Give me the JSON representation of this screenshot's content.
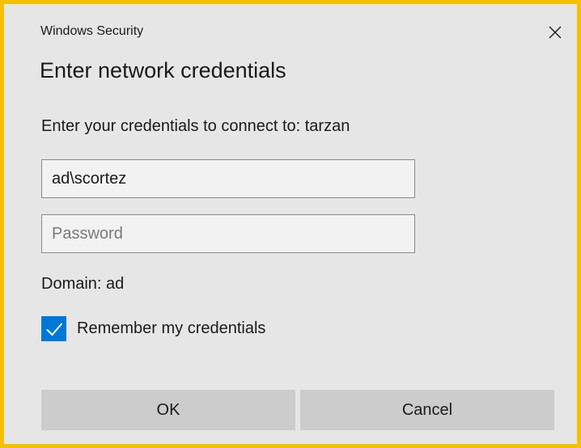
{
  "window": {
    "title": "Windows Security",
    "close_icon": "close-icon"
  },
  "heading": "Enter network credentials",
  "prompt": "Enter your credentials to connect to: tarzan",
  "username": {
    "value": "ad\\scortez"
  },
  "password": {
    "value": "",
    "placeholder": "Password"
  },
  "domain": "Domain: ad",
  "remember": {
    "label": "Remember my credentials",
    "checked": true,
    "icon": "checkmark-icon"
  },
  "buttons": {
    "ok_label": "OK",
    "cancel_label": "Cancel"
  },
  "colors": {
    "accent": "#0078d7",
    "border_highlight": "#f5c000",
    "background": "#e6e6e6",
    "button": "#cccccc"
  }
}
